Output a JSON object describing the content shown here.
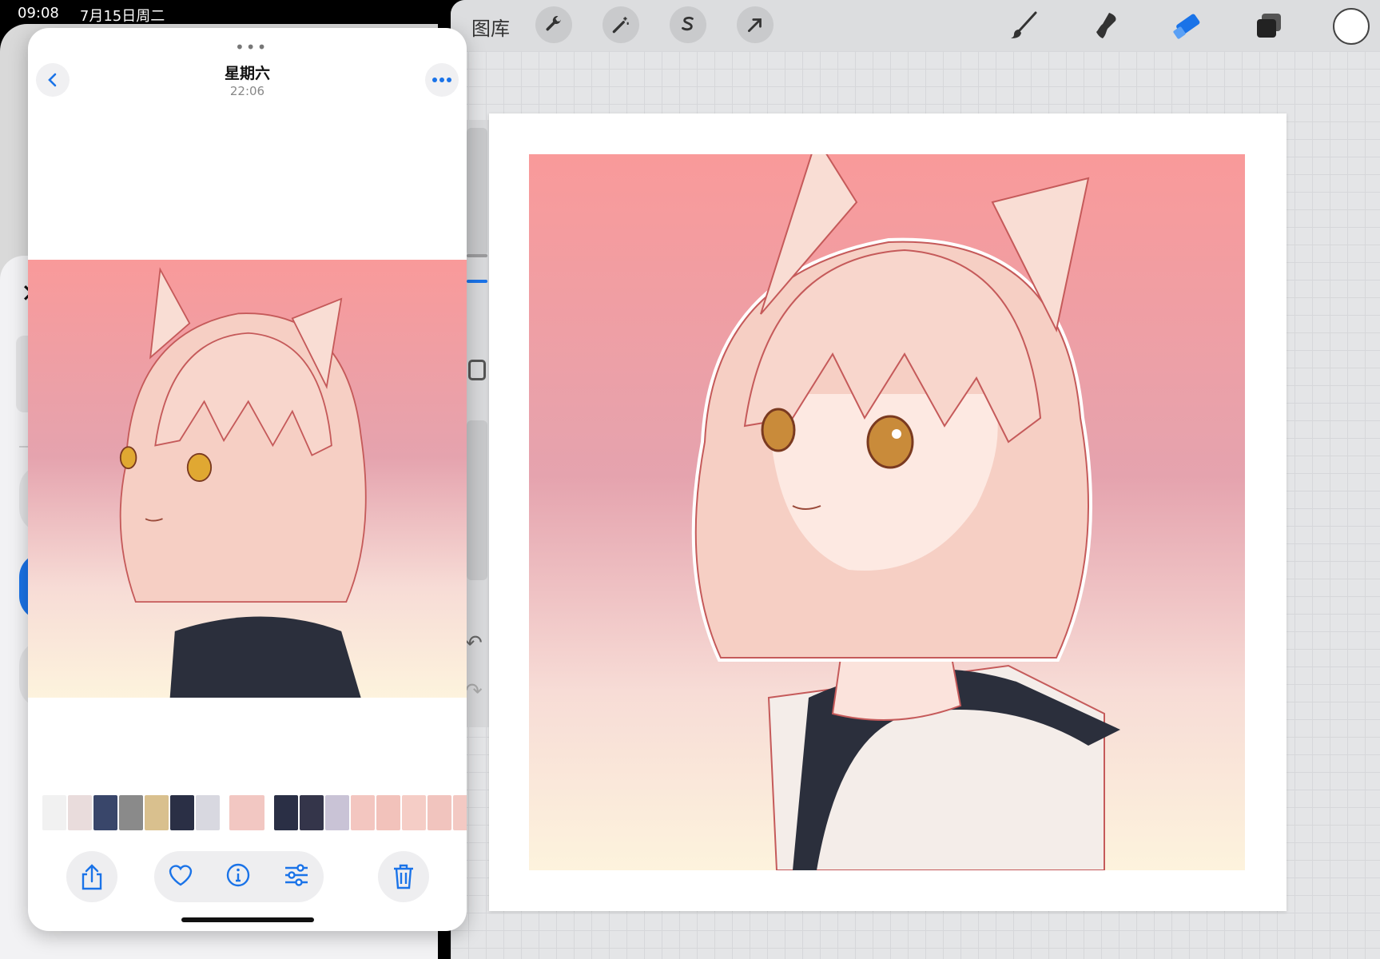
{
  "status": {
    "time": "09:08",
    "date": "7月15日周二"
  },
  "procreate": {
    "gallery_label": "图库",
    "tools_left": [
      "wrench-icon",
      "magic-wand-icon",
      "selection-icon",
      "transform-arrow-icon"
    ],
    "tools_right": [
      "brush-icon",
      "smudge-icon",
      "eraser-icon",
      "layers-icon"
    ],
    "active_tool": "eraser-icon",
    "active_color": "#ffffff",
    "accent": "#1a73e8"
  },
  "photos": {
    "title": "星期六",
    "subtitle": "22:06",
    "thumb_count": 18,
    "actions": [
      "share-icon",
      "heart-icon",
      "info-icon",
      "adjust-icon",
      "trash-icon"
    ]
  },
  "artwork": {
    "bg_top": "#f99a9a",
    "bg_mid": "#e3a5ad",
    "bg_bottom": "#fdf2dc",
    "hair": "#f6cfc4",
    "outline": "#c55a5a",
    "hood": "#2b2f3c"
  }
}
